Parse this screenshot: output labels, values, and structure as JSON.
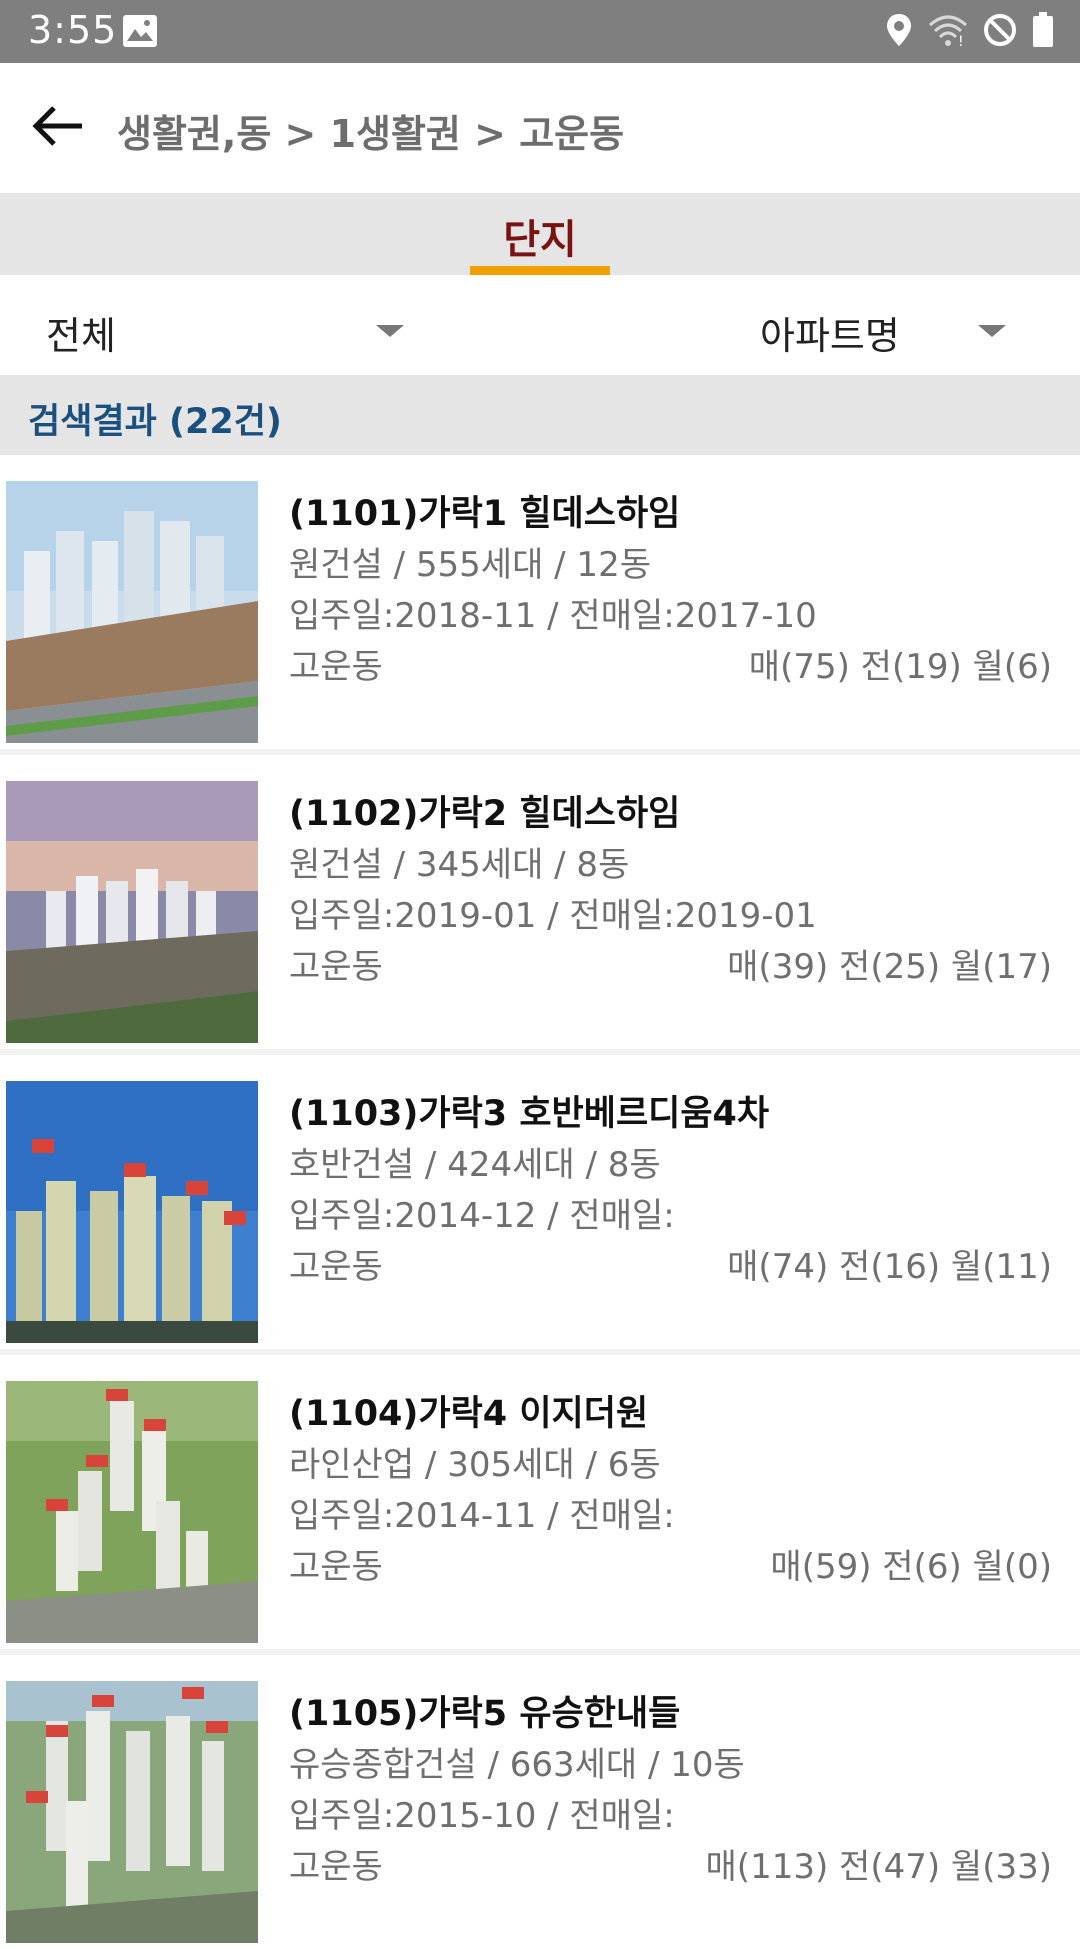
{
  "status_bar": {
    "time": "3:55",
    "icons": [
      "image-icon",
      "location-icon",
      "wifi-icon",
      "do-not-disturb-icon",
      "battery-icon"
    ]
  },
  "header": {
    "breadcrumb": "생활권,동 > 1생활권 > 고운동"
  },
  "tabs": [
    {
      "label": "단지",
      "active": true
    }
  ],
  "filters": {
    "category": "전체",
    "sort": "아파트명"
  },
  "results": {
    "label": "검색결과 (22건)"
  },
  "items": [
    {
      "name": "(1101)가락1 힐데스하임",
      "builder": "원건설 / 555세대 / 12동",
      "dates": "입주일:2018-11 / 전매일:2017-10",
      "area": "고운동",
      "counts": "매(75) 전(19) 월(6)"
    },
    {
      "name": "(1102)가락2 힐데스하임",
      "builder": "원건설 / 345세대 / 8동",
      "dates": "입주일:2019-01 / 전매일:2019-01",
      "area": "고운동",
      "counts": "매(39) 전(25) 월(17)"
    },
    {
      "name": "(1103)가락3 호반베르디움4차",
      "builder": "호반건설 / 424세대 / 8동",
      "dates": "입주일:2014-12 / 전매일:",
      "area": "고운동",
      "counts": "매(74) 전(16) 월(11)"
    },
    {
      "name": "(1104)가락4 이지더원",
      "builder": "라인산업 / 305세대 / 6동",
      "dates": "입주일:2014-11 / 전매일:",
      "area": "고운동",
      "counts": "매(59) 전(6) 월(0)"
    },
    {
      "name": "(1105)가락5 유승한내들",
      "builder": "유승종합건설 / 663세대 / 10동",
      "dates": "입주일:2015-10 / 전매일:",
      "area": "고운동",
      "counts": "매(113) 전(47) 월(33)"
    }
  ],
  "colors": {
    "status_bar": "#7f7f7f",
    "tab_active_text": "#7a1212",
    "tab_indicator": "#f0a000",
    "result_header_text": "#1a5080",
    "section_bg": "#e5e5e5"
  }
}
